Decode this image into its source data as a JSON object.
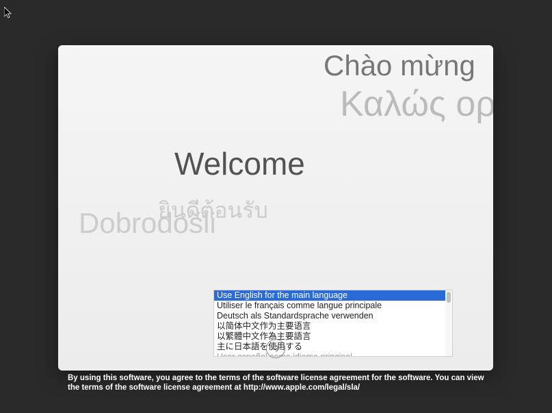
{
  "welcome_words": {
    "vietnamese": "Chào mừng",
    "greek": "Καλώς ορίσατε",
    "main": "Welcome",
    "thai": "ยินดีต้อนรับ",
    "slovenian": "Dobrodošli"
  },
  "languages": [
    "Use English for the main language",
    "Utiliser le français comme langue principale",
    "Deutsch als Standardsprache verwenden",
    "以简体中文作为主要语言",
    "以繁體中文作為主要語言",
    "主に日本語を使用する",
    "Usar español como idioma principal"
  ],
  "selected_index": 0,
  "license_text": "By using this software, you agree to the terms of the software license agreement for the software. You can view the terms of the software license agreement at http://www.apple.com/legal/sla/"
}
